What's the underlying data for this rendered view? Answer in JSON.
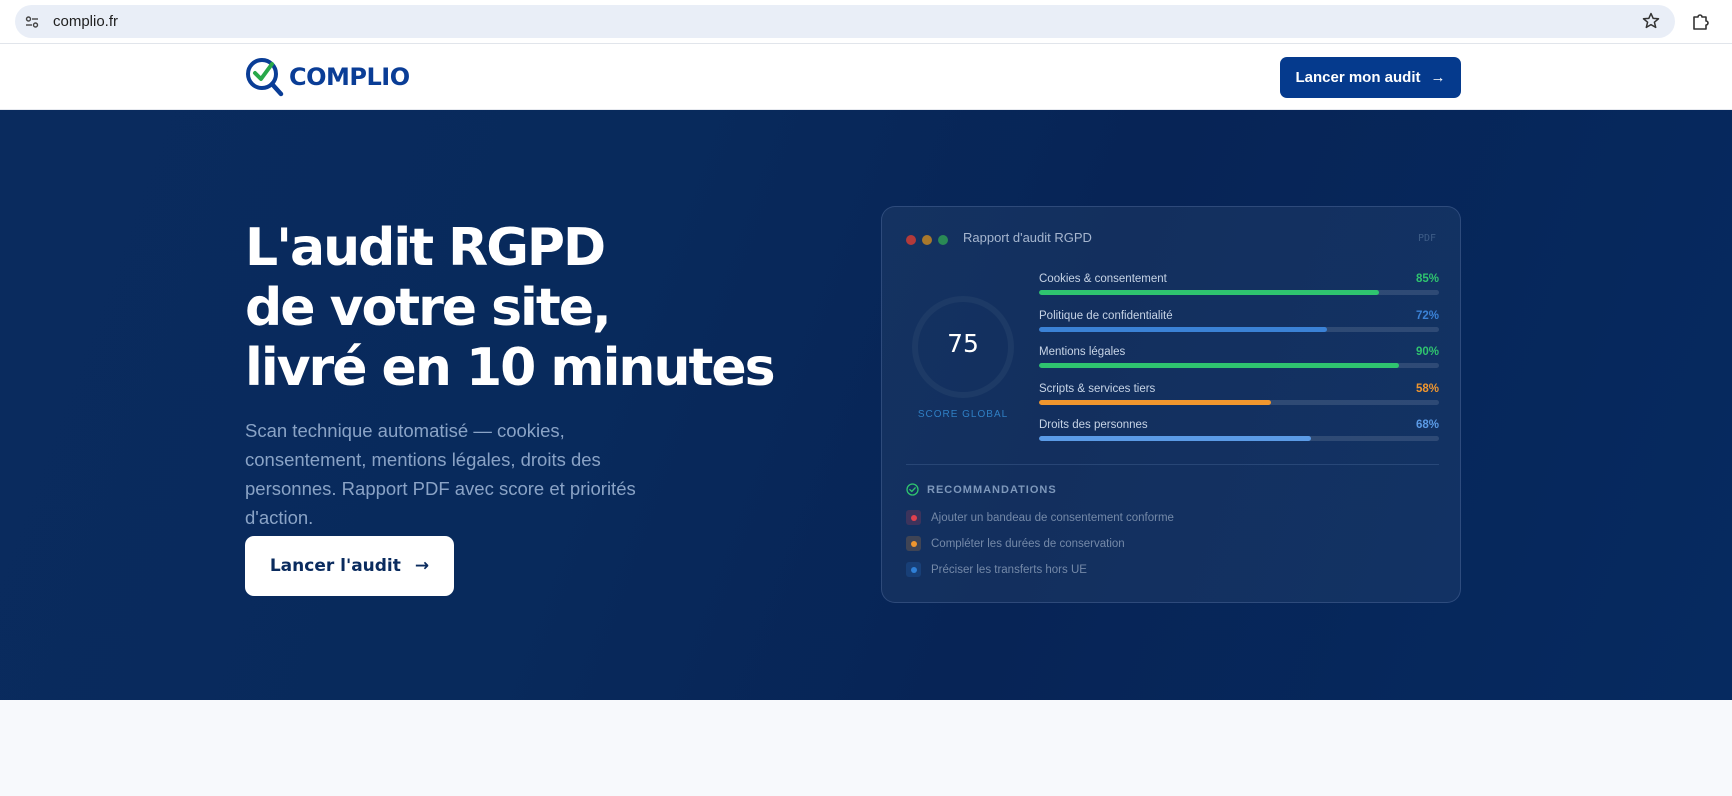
{
  "browser": {
    "url": "complio.fr",
    "icons": [
      "site-info-icon",
      "star-icon",
      "extensions-icon"
    ]
  },
  "nav": {
    "logo_text": "COMPLIO",
    "cta_label": "Lancer mon audit",
    "cta_arrow": "→"
  },
  "hero": {
    "title_lines": [
      "L'audit RGPD",
      "de votre site,",
      "livré en 10 minutes"
    ],
    "subtitle": "Scan technique automatisé — cookies, consentement, mentions légales, droits des personnes. Rapport PDF avec score et priorités d'action.",
    "cta_label": "Lancer l'audit",
    "cta_arrow": "→"
  },
  "report": {
    "title": "Rapport d'audit RGPD",
    "tag": "PDF",
    "window_dot_colors": [
      "#b33a3a",
      "#a8782c",
      "#2a8a55"
    ],
    "score": {
      "value": "75",
      "label": "SCORE GLOBAL",
      "fraction": 0.75,
      "color": "#1f3f6e"
    },
    "metrics": [
      {
        "name": "Cookies & consentement",
        "value": "85%",
        "fraction": 0.85,
        "color": "#2fc46f"
      },
      {
        "name": "Politique de confidentialité",
        "value": "72%",
        "fraction": 0.72,
        "color": "#3b82d6"
      },
      {
        "name": "Mentions légales",
        "value": "90%",
        "fraction": 0.9,
        "color": "#2fc46f"
      },
      {
        "name": "Scripts & services tiers",
        "value": "58%",
        "fraction": 0.58,
        "color": "#f0962e"
      },
      {
        "name": "Droits des personnes",
        "value": "68%",
        "fraction": 0.68,
        "color": "#5b9be6"
      }
    ],
    "recommendations_title": "RECOMMANDATIONS",
    "recommendations": [
      {
        "text": "Ajouter un bandeau de consentement conforme",
        "color": "#e0414e"
      },
      {
        "text": "Compléter les durées de conservation",
        "color": "#f0962e"
      },
      {
        "text": "Préciser les transferts hors UE",
        "color": "#2f7fd6"
      }
    ]
  }
}
